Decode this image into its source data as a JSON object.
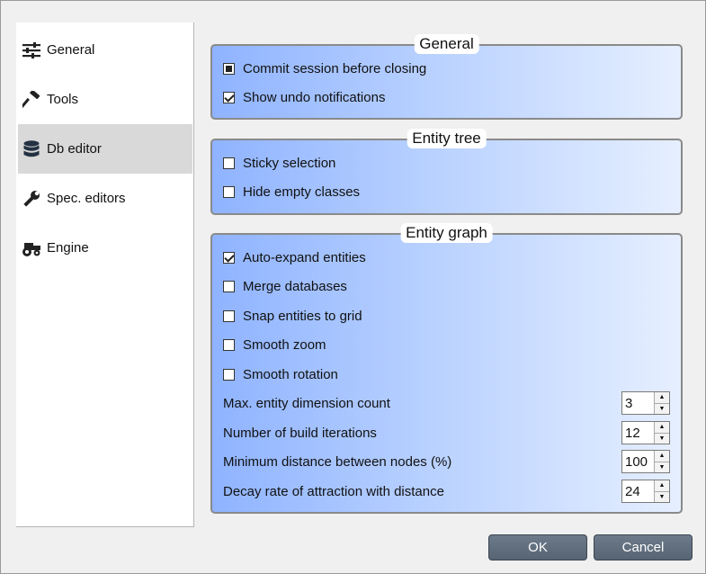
{
  "sidebar": {
    "items": [
      {
        "label": "General",
        "icon": "sliders-icon"
      },
      {
        "label": "Tools",
        "icon": "hammer-icon"
      },
      {
        "label": "Db editor",
        "icon": "database-icon"
      },
      {
        "label": "Spec. editors",
        "icon": "wrench-icon"
      },
      {
        "label": "Engine",
        "icon": "tractor-icon"
      }
    ],
    "selected": "Db editor"
  },
  "general_group": {
    "title": "General",
    "options": [
      {
        "label": "Commit session before closing",
        "state": "partial"
      },
      {
        "label": "Show undo notifications",
        "state": "checked"
      }
    ]
  },
  "entity_tree_group": {
    "title": "Entity tree",
    "options": [
      {
        "label": "Sticky selection",
        "state": "unchecked"
      },
      {
        "label": "Hide empty classes",
        "state": "unchecked"
      }
    ]
  },
  "entity_graph_group": {
    "title": "Entity graph",
    "options": [
      {
        "label": "Auto-expand entities",
        "state": "checked"
      },
      {
        "label": "Merge databases",
        "state": "unchecked"
      },
      {
        "label": "Snap entities to grid",
        "state": "unchecked"
      },
      {
        "label": "Smooth zoom",
        "state": "unchecked"
      },
      {
        "label": "Smooth rotation",
        "state": "unchecked"
      }
    ],
    "spinners": [
      {
        "label": "Max. entity dimension count",
        "value": "3"
      },
      {
        "label": "Number of build iterations",
        "value": "12"
      },
      {
        "label": "Minimum distance between nodes (%)",
        "value": "100"
      },
      {
        "label": "Decay rate of attraction with distance",
        "value": "24"
      }
    ]
  },
  "buttons": {
    "ok": "OK",
    "cancel": "Cancel"
  },
  "colors": {
    "group_gradient_start": "#8fb3ff",
    "group_gradient_end": "#e6efff",
    "button": "#5f6d7c",
    "selected_item": "#d9d9d9"
  }
}
